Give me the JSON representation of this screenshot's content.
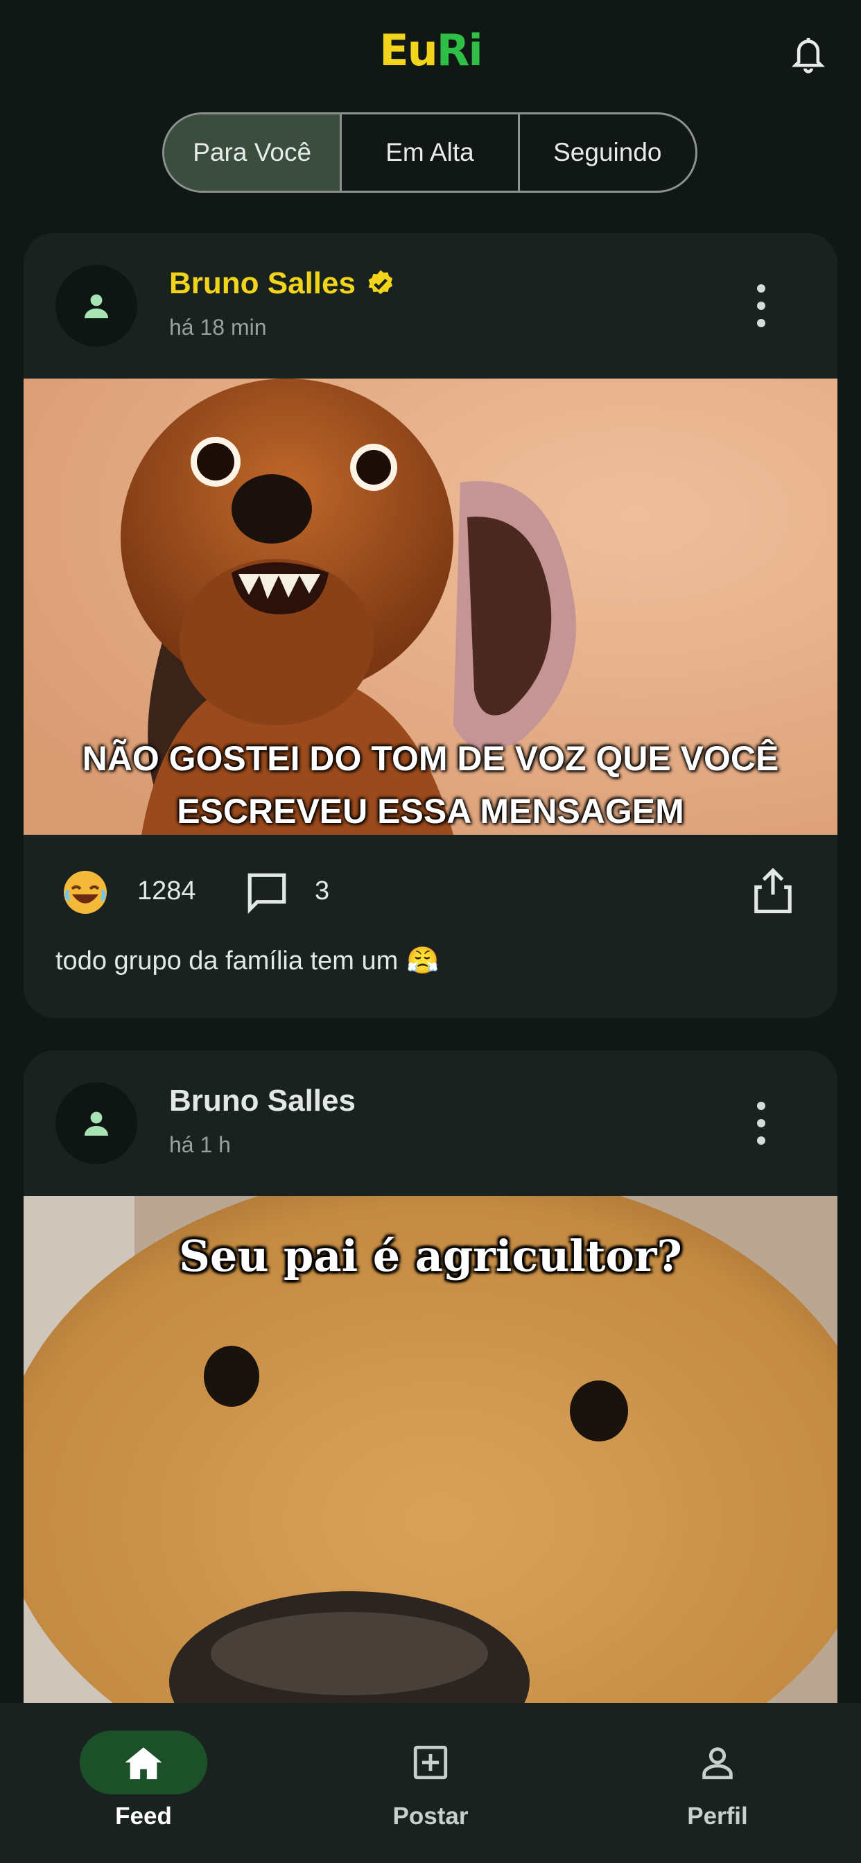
{
  "app": {
    "logo_part1": "Eu",
    "logo_part2": "Ri",
    "logo_colors": {
      "eu": "#f2d51b",
      "ri": "#2fbf46"
    },
    "notifications_icon": "bell-icon"
  },
  "tabs": [
    {
      "label": "Para Você",
      "active": true
    },
    {
      "label": "Em Alta",
      "active": false
    },
    {
      "label": "Seguindo",
      "active": false
    }
  ],
  "posts": [
    {
      "author": "Bruno Salles",
      "verified": true,
      "time": "há 18 min",
      "image_caption_line1": "NÃO GOSTEI DO TOM DE VOZ QUE VOCÊ",
      "image_caption_line2": "ESCREVEU ESSA MENSAGEM",
      "reaction_emoji": "😂",
      "reactions": "1284",
      "comments": "3",
      "text": "todo grupo da família tem um",
      "text_emoji": "😤"
    },
    {
      "author": "Bruno Salles",
      "verified": false,
      "time": "há 1 h",
      "image_caption": "Seu pai é agricultor?"
    }
  ],
  "bottom_nav": [
    {
      "label": "Feed",
      "icon": "home-icon",
      "active": true
    },
    {
      "label": "Postar",
      "icon": "add-box-icon",
      "active": false
    },
    {
      "label": "Perfil",
      "icon": "person-icon",
      "active": false
    }
  ]
}
